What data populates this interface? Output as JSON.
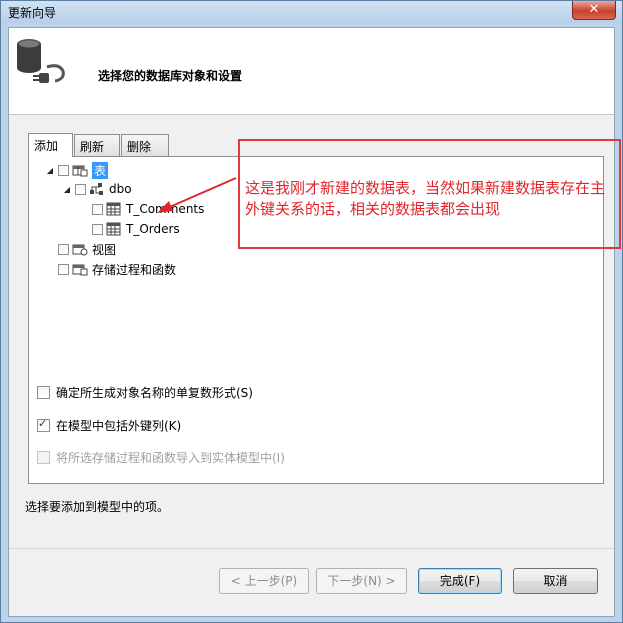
{
  "window": {
    "title": "更新向导",
    "close_glyph": "✕"
  },
  "header": {
    "title": "选择您的数据库对象和设置",
    "icon": "database-plug-icon"
  },
  "tabs": [
    {
      "label": "添加",
      "active": true
    },
    {
      "label": "刷新",
      "active": false
    },
    {
      "label": "删除",
      "active": false
    }
  ],
  "tree": {
    "tables": {
      "label": "表",
      "expanded": true,
      "checked": false
    },
    "dbo": {
      "label": "dbo",
      "expanded": true,
      "checked": false
    },
    "items": [
      {
        "label": "T_Comments",
        "checked": false
      },
      {
        "label": "T_Orders",
        "checked": false
      }
    ],
    "views": {
      "label": "视图",
      "checked": false
    },
    "procs": {
      "label": "存储过程和函数",
      "checked": false
    }
  },
  "options": {
    "pluralize": {
      "label": "确定所生成对象名称的单复数形式(S)",
      "checked": false,
      "enabled": true
    },
    "foreign_keys": {
      "label": "在模型中包括外键列(K)",
      "checked": true,
      "enabled": true
    },
    "import_procs": {
      "label": "将所选存储过程和函数导入到实体模型中(I)",
      "checked": false,
      "enabled": false
    }
  },
  "hint": "选择要添加到模型中的项。",
  "buttons": {
    "prev": "< 上一步(P)",
    "next": "下一步(N) >",
    "finish": "完成(F)",
    "cancel": "取消"
  },
  "annotation": {
    "text": "这是我刚才新建的数据表，当然如果新建数据表存在主外键关系的话，相关的数据表都会出现",
    "color": "#e0262a"
  }
}
